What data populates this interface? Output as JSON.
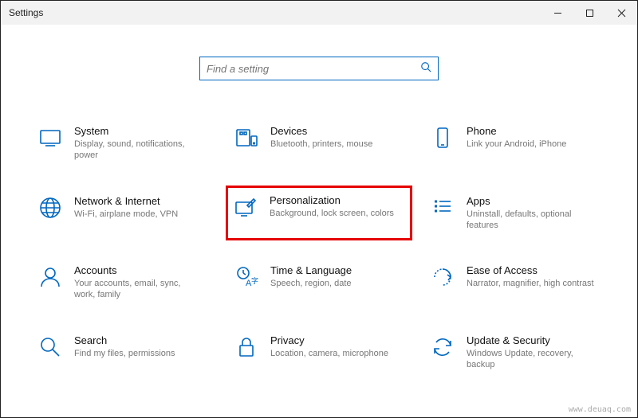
{
  "window": {
    "title": "Settings"
  },
  "search": {
    "placeholder": "Find a setting"
  },
  "tiles": {
    "system": {
      "name": "System",
      "desc": "Display, sound, notifications, power"
    },
    "devices": {
      "name": "Devices",
      "desc": "Bluetooth, printers, mouse"
    },
    "phone": {
      "name": "Phone",
      "desc": "Link your Android, iPhone"
    },
    "network": {
      "name": "Network & Internet",
      "desc": "Wi-Fi, airplane mode, VPN"
    },
    "personalization": {
      "name": "Personalization",
      "desc": "Background, lock screen, colors"
    },
    "apps": {
      "name": "Apps",
      "desc": "Uninstall, defaults, optional features"
    },
    "accounts": {
      "name": "Accounts",
      "desc": "Your accounts, email, sync, work, family"
    },
    "time": {
      "name": "Time & Language",
      "desc": "Speech, region, date"
    },
    "ease": {
      "name": "Ease of Access",
      "desc": "Narrator, magnifier, high contrast"
    },
    "search_tile": {
      "name": "Search",
      "desc": "Find my files, permissions"
    },
    "privacy": {
      "name": "Privacy",
      "desc": "Location, camera, microphone"
    },
    "update": {
      "name": "Update & Security",
      "desc": "Windows Update, recovery, backup"
    }
  },
  "watermark": "www.deuaq.com"
}
